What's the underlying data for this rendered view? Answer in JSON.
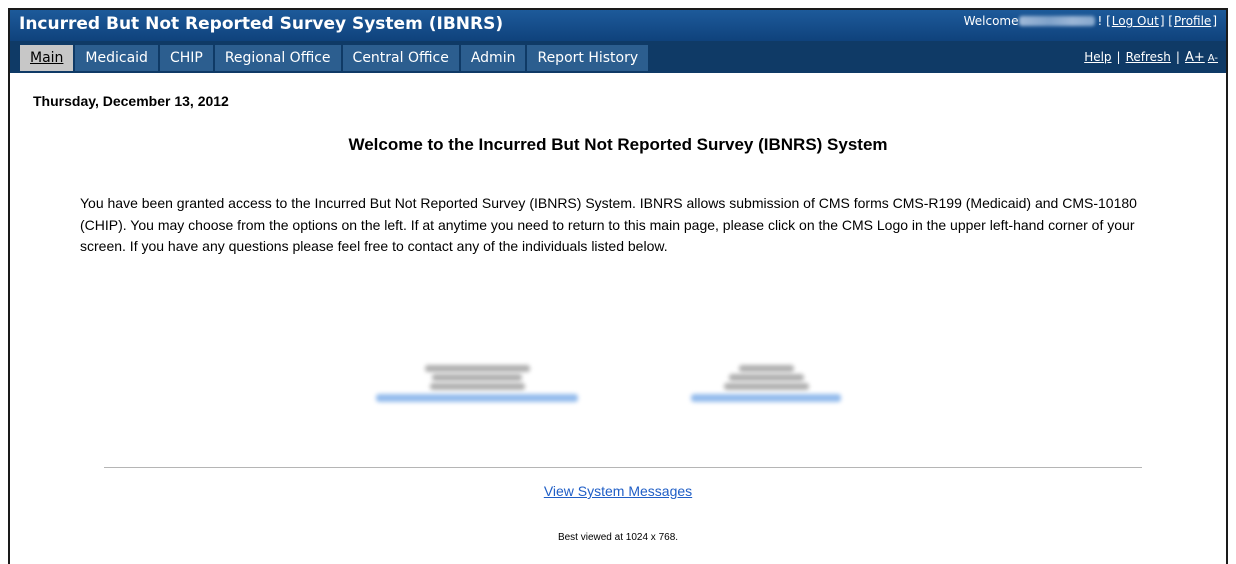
{
  "header": {
    "title": "Incurred But Not Reported Survey System (IBNRS)",
    "welcome_label": "Welcome",
    "logout_label": "Log Out",
    "profile_label": "Profile"
  },
  "nav": {
    "tabs": [
      {
        "label": "Main",
        "active": true
      },
      {
        "label": "Medicaid"
      },
      {
        "label": "CHIP"
      },
      {
        "label": "Regional Office"
      },
      {
        "label": "Central Office"
      },
      {
        "label": "Admin"
      },
      {
        "label": "Report History"
      }
    ],
    "help_label": "Help",
    "refresh_label": "Refresh",
    "font_increase_label": "A+",
    "font_decrease_label": "A-"
  },
  "main": {
    "date": "Thursday, December 13, 2012",
    "title": "Welcome to the Incurred But Not Reported Survey (IBNRS) System",
    "intro": "You have been granted access to the Incurred But Not Reported Survey (IBNRS) System. IBNRS allows submission of CMS forms CMS-R199 (Medicaid) and CMS-10180 (CHIP). You may choose from the options on the left. If at anytime you need to return to this main page, please click on the CMS Logo in the upper left-hand corner of your screen. If you have any questions please feel free to contact any of the individuals listed below."
  },
  "footer": {
    "system_messages_link": "View System Messages",
    "best_viewed": "Best viewed at 1024 x 768."
  },
  "colors": {
    "header_bg": "#15508f",
    "nav_bg": "#0f3a66",
    "tab_bg": "#2c5e8f",
    "active_tab_bg": "#c7c7c7",
    "link": "#1f5ec6"
  }
}
